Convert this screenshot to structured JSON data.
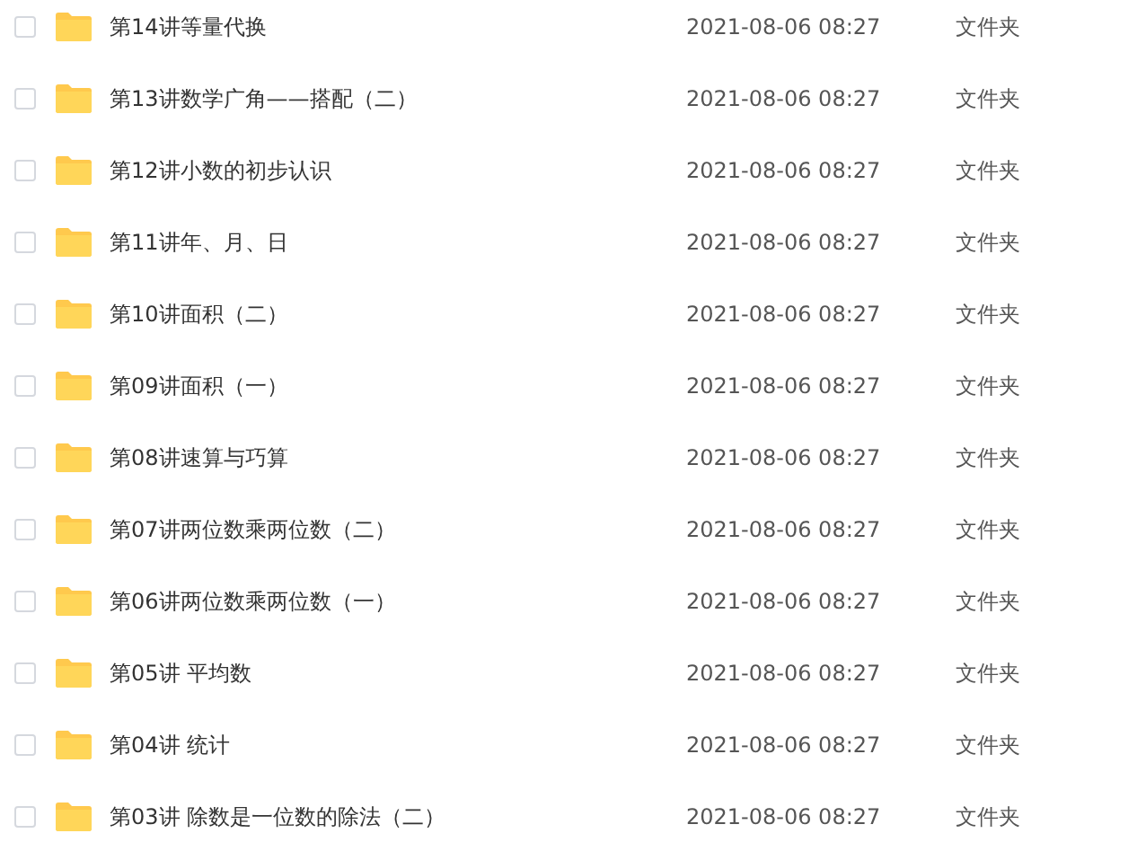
{
  "files": [
    {
      "name": "第14讲等量代换",
      "modified": "2021-08-06 08:27",
      "type": "文件夹",
      "checked": false
    },
    {
      "name": "第13讲数学广角——搭配（二）",
      "modified": "2021-08-06 08:27",
      "type": "文件夹",
      "checked": false
    },
    {
      "name": "第12讲小数的初步认识",
      "modified": "2021-08-06 08:27",
      "type": "文件夹",
      "checked": false
    },
    {
      "name": "第11讲年、月、日",
      "modified": "2021-08-06 08:27",
      "type": "文件夹",
      "checked": false
    },
    {
      "name": "第10讲面积（二）",
      "modified": "2021-08-06 08:27",
      "type": "文件夹",
      "checked": false
    },
    {
      "name": "第09讲面积（一）",
      "modified": "2021-08-06 08:27",
      "type": "文件夹",
      "checked": false
    },
    {
      "name": "第08讲速算与巧算",
      "modified": "2021-08-06 08:27",
      "type": "文件夹",
      "checked": false
    },
    {
      "name": "第07讲两位数乘两位数（二）",
      "modified": "2021-08-06 08:27",
      "type": "文件夹",
      "checked": false
    },
    {
      "name": "第06讲两位数乘两位数（一）",
      "modified": "2021-08-06 08:27",
      "type": "文件夹",
      "checked": false
    },
    {
      "name": "第05讲 平均数",
      "modified": "2021-08-06 08:27",
      "type": "文件夹",
      "checked": false
    },
    {
      "name": "第04讲 统计",
      "modified": "2021-08-06 08:27",
      "type": "文件夹",
      "checked": false
    },
    {
      "name": "第03讲 除数是一位数的除法（二）",
      "modified": "2021-08-06 08:27",
      "type": "文件夹",
      "checked": false
    }
  ]
}
